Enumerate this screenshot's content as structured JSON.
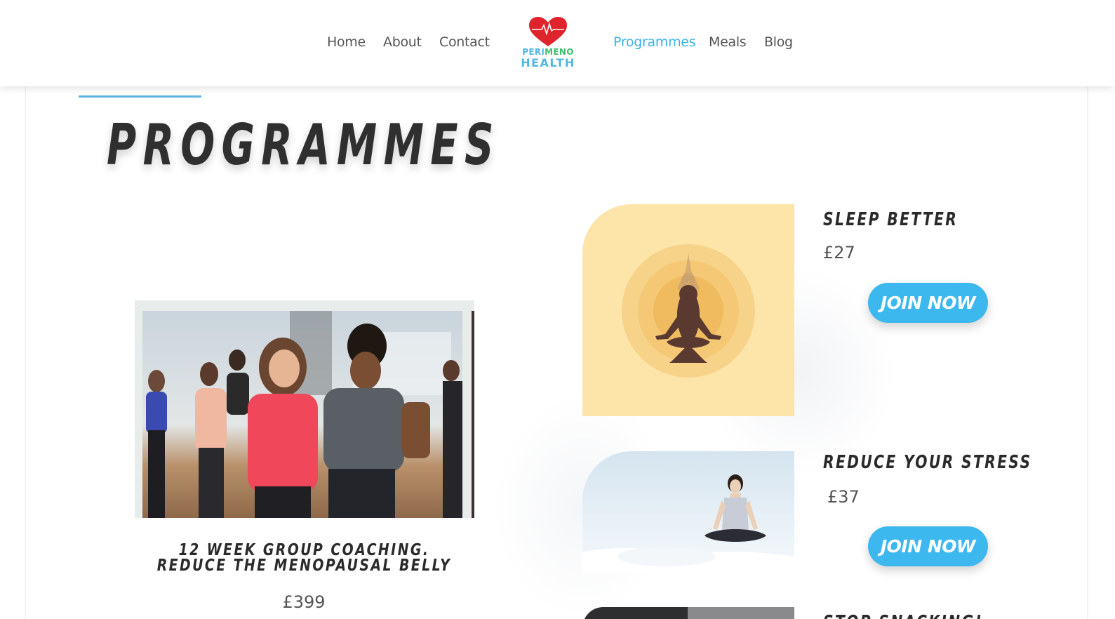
{
  "nav": {
    "left": [
      "Home",
      "About",
      "Contact"
    ],
    "right": [
      "Programmes",
      "Meals",
      "Blog"
    ],
    "active": "Programmes"
  },
  "logo": {
    "line1_a": "PERI",
    "line1_b": "MENO",
    "line2": "HEALTH",
    "icon": "heart-heartbeat-icon"
  },
  "page": {
    "title": "PROGRAMMES"
  },
  "main_programme": {
    "title": "12 WEEK GROUP COACHING. REDUCE THE MENOPAUSAL BELLY",
    "price": "£399",
    "image": "group-fitness-class-photo"
  },
  "programmes": [
    {
      "title": "SLEEP BETTER",
      "price": "£27",
      "button": "JOIN NOW",
      "image": "meditation-silhouette-illustration"
    },
    {
      "title": "REDUCE YOUR STRESS",
      "price": "£37",
      "button": "JOIN NOW",
      "image": "woman-meditating-in-clouds-photo"
    },
    {
      "title": "STOP SNACKING!",
      "image": "programme-photo"
    }
  ],
  "colors": {
    "accent": "#3bb3e7",
    "button": "#3db8ef",
    "heart": "#e0242b",
    "sleep_bg": "#fde4a8"
  }
}
